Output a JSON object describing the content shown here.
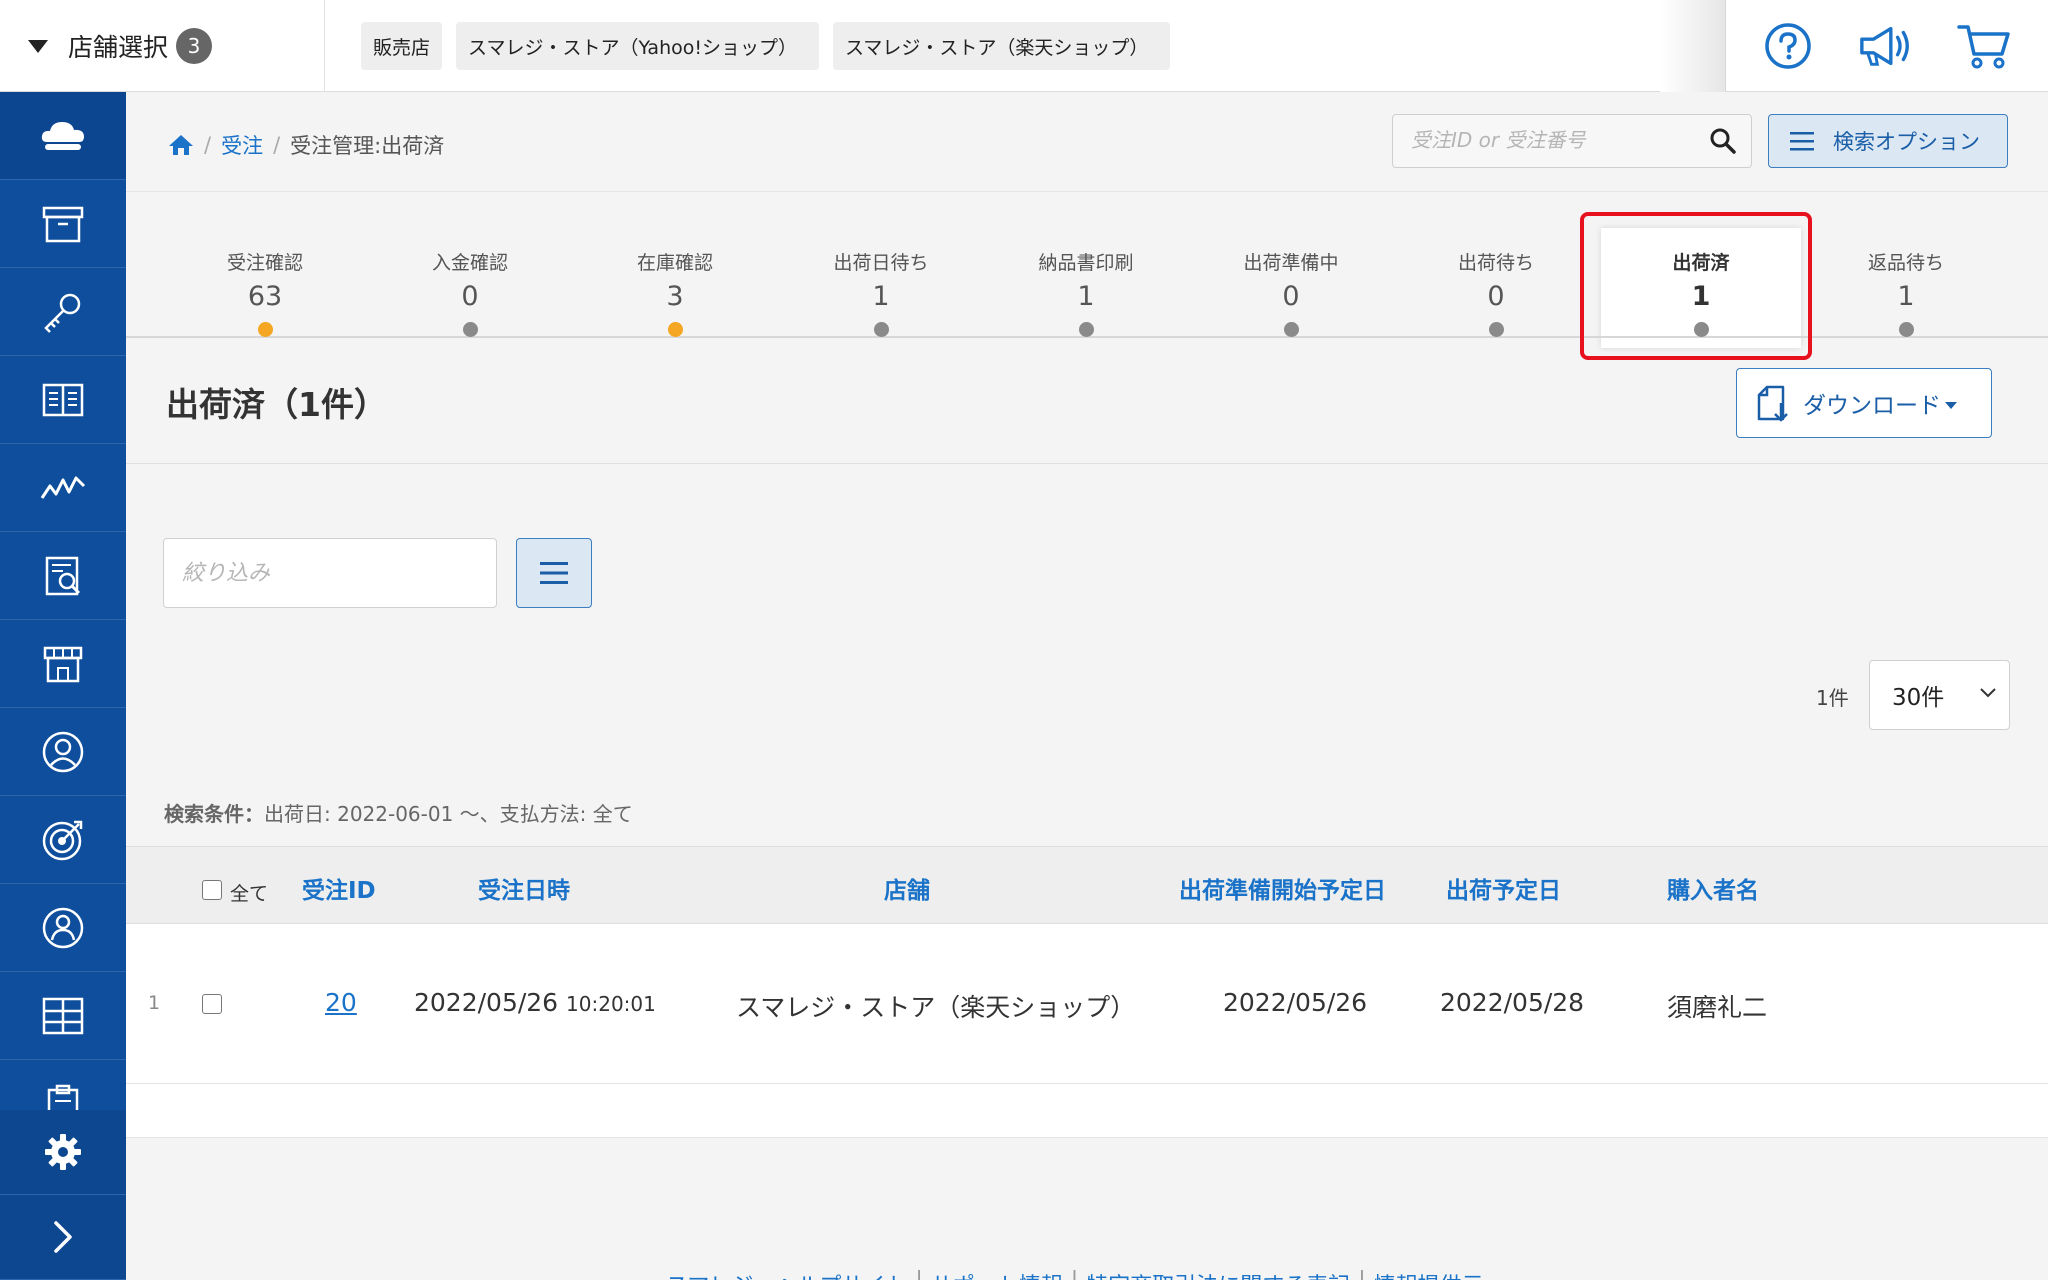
{
  "topbar": {
    "store_select_label": "店舗選択",
    "store_count": "3",
    "chips": [
      "販売店",
      "スマレジ・ストア（Yahoo!ショップ）",
      "スマレジ・ストア（楽天ショップ）"
    ],
    "icons": [
      "help-icon",
      "announcement-icon",
      "cart-icon"
    ]
  },
  "sidebar": {
    "items": [
      "cloud-icon",
      "archive-icon",
      "key-icon",
      "book-icon",
      "analytics-icon",
      "report-icon",
      "store-icon",
      "user-icon",
      "target-icon",
      "member-icon",
      "grid-icon",
      "clipboard-icon"
    ],
    "bottom": [
      "settings-icon",
      "expand-icon"
    ]
  },
  "breadcrumb": {
    "home": "home-icon",
    "level1": "受注",
    "current": "受注管理:出荷済"
  },
  "search": {
    "placeholder": "受注ID or 受注番号",
    "option_label": "検索オプション"
  },
  "steps": [
    {
      "label": "受注確認",
      "count": "63",
      "dot": "orange"
    },
    {
      "label": "入金確認",
      "count": "0",
      "dot": "gray"
    },
    {
      "label": "在庫確認",
      "count": "3",
      "dot": "orange"
    },
    {
      "label": "出荷日待ち",
      "count": "1",
      "dot": "gray"
    },
    {
      "label": "納品書印刷",
      "count": "1",
      "dot": "gray"
    },
    {
      "label": "出荷準備中",
      "count": "0",
      "dot": "gray"
    },
    {
      "label": "出荷待ち",
      "count": "0",
      "dot": "gray"
    },
    {
      "label": "出荷済",
      "count": "1",
      "dot": "gray",
      "active": true
    },
    {
      "label": "返品待ち",
      "count": "1",
      "dot": "gray"
    }
  ],
  "page": {
    "title": "出荷済（1件）",
    "download_label": "ダウンロード",
    "filter_placeholder": "絞り込み",
    "result_count": "1件",
    "per_page": "30件",
    "conditions_label": "検索条件：",
    "conditions_text": "出荷日: 2022-06-01 〜、支払方法: 全て"
  },
  "table": {
    "select_all_label": "全て",
    "headers": [
      "受注ID",
      "受注日時",
      "店舗",
      "出荷準備開始予定日",
      "出荷予定日",
      "購入者名"
    ],
    "rows": [
      {
        "num": "1",
        "order_id": "20",
        "order_date": "2022/05/26",
        "order_time": "10:20:01",
        "store": "スマレジ・ストア（楽天ショップ）",
        "prep_date": "2022/05/26",
        "ship_date": "2022/05/28",
        "buyer": "須磨礼二"
      }
    ]
  },
  "footer": {
    "links": [
      "スマレジ・ヘルプサイト",
      "サポート情報",
      "特定商取引法に関する表記",
      "情報提供元"
    ]
  },
  "colors": {
    "sidebar": "#0f4e9c",
    "accent": "#1a73c8",
    "highlight": "#e8121e",
    "orange_dot": "#f5a623"
  }
}
